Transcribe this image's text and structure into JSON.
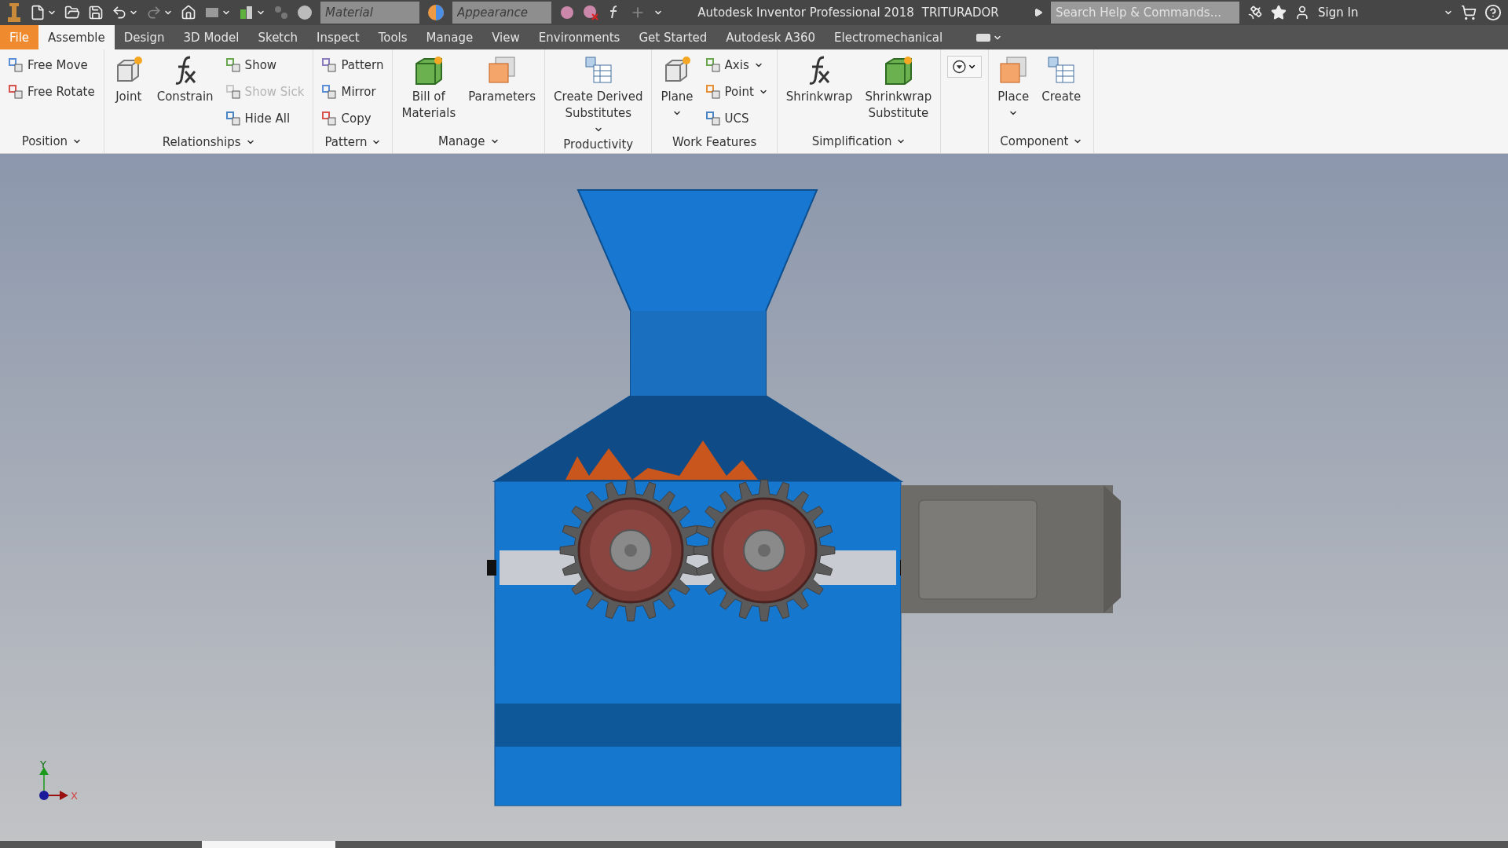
{
  "title_bar": {
    "material_placeholder": "Material",
    "appearance_placeholder": "Appearance",
    "app_title": "Autodesk Inventor Professional 2018",
    "document": "TRITURADOR",
    "search_placeholder": "Search Help & Commands...",
    "sign_in": "Sign In"
  },
  "tabs": [
    {
      "label": "File",
      "kind": "file",
      "selected": false
    },
    {
      "label": "Assemble",
      "kind": "tab",
      "selected": true
    },
    {
      "label": "Design",
      "kind": "tab",
      "selected": false
    },
    {
      "label": "3D Model",
      "kind": "tab",
      "selected": false
    },
    {
      "label": "Sketch",
      "kind": "tab",
      "selected": false
    },
    {
      "label": "Inspect",
      "kind": "tab",
      "selected": false
    },
    {
      "label": "Tools",
      "kind": "tab",
      "selected": false
    },
    {
      "label": "Manage",
      "kind": "tab",
      "selected": false
    },
    {
      "label": "View",
      "kind": "tab",
      "selected": false
    },
    {
      "label": "Environments",
      "kind": "tab",
      "selected": false
    },
    {
      "label": "Get Started",
      "kind": "tab",
      "selected": false
    },
    {
      "label": "Autodesk A360",
      "kind": "tab",
      "selected": false
    },
    {
      "label": "Electromechanical",
      "kind": "tab",
      "selected": false
    }
  ],
  "panels": [
    {
      "label": "Position",
      "has_menu": true,
      "columns": [
        {
          "kind": "stack",
          "items": [
            {
              "label": "Free Move",
              "disabled": false
            },
            {
              "label": "Free Rotate",
              "disabled": false
            }
          ]
        }
      ]
    },
    {
      "label": "Relationships",
      "has_menu": true,
      "columns": [
        {
          "kind": "large",
          "label": "Joint",
          "has_menu": false
        },
        {
          "kind": "large",
          "label": "Constrain",
          "has_menu": false
        },
        {
          "kind": "stack",
          "items": [
            {
              "label": "Show",
              "disabled": false
            },
            {
              "label": "Show Sick",
              "disabled": true
            },
            {
              "label": "Hide All",
              "disabled": false
            }
          ]
        }
      ]
    },
    {
      "label": "Pattern",
      "has_menu": true,
      "columns": [
        {
          "kind": "stack",
          "items": [
            {
              "label": "Pattern",
              "disabled": false
            },
            {
              "label": "Mirror",
              "disabled": false
            },
            {
              "label": "Copy",
              "disabled": false
            }
          ]
        }
      ]
    },
    {
      "label": "Manage",
      "has_menu": true,
      "columns": [
        {
          "kind": "large",
          "label": "Bill of\nMaterials",
          "has_menu": false
        },
        {
          "kind": "large",
          "label": "Parameters",
          "has_menu": false
        }
      ]
    },
    {
      "label": "Productivity",
      "has_menu": false,
      "columns": [
        {
          "kind": "large",
          "label": "Create Derived\nSubstitutes",
          "has_menu": true
        }
      ]
    },
    {
      "label": "Work Features",
      "has_menu": false,
      "columns": [
        {
          "kind": "large",
          "label": "Plane",
          "has_menu": true
        },
        {
          "kind": "stack",
          "items": [
            {
              "label": "Axis",
              "disabled": false,
              "has_menu": true
            },
            {
              "label": "Point",
              "disabled": false,
              "has_menu": true
            },
            {
              "label": "UCS",
              "disabled": false,
              "has_menu": false
            }
          ]
        }
      ]
    },
    {
      "label": "Simplification",
      "has_menu": true,
      "columns": [
        {
          "kind": "large",
          "label": "Shrinkwrap",
          "has_menu": false
        },
        {
          "kind": "large",
          "label": "Shrinkwrap\nSubstitute",
          "has_menu": false
        }
      ]
    },
    {
      "columns": [
        {
          "kind": "dropdown"
        }
      ]
    },
    {
      "label": "Component",
      "has_menu": true,
      "columns": [
        {
          "kind": "large",
          "label": "Place",
          "has_menu": true
        },
        {
          "kind": "large",
          "label": "Create",
          "has_menu": false
        }
      ]
    }
  ],
  "viewport": {
    "axis_labels": {
      "x": "X",
      "y": "Y"
    }
  }
}
